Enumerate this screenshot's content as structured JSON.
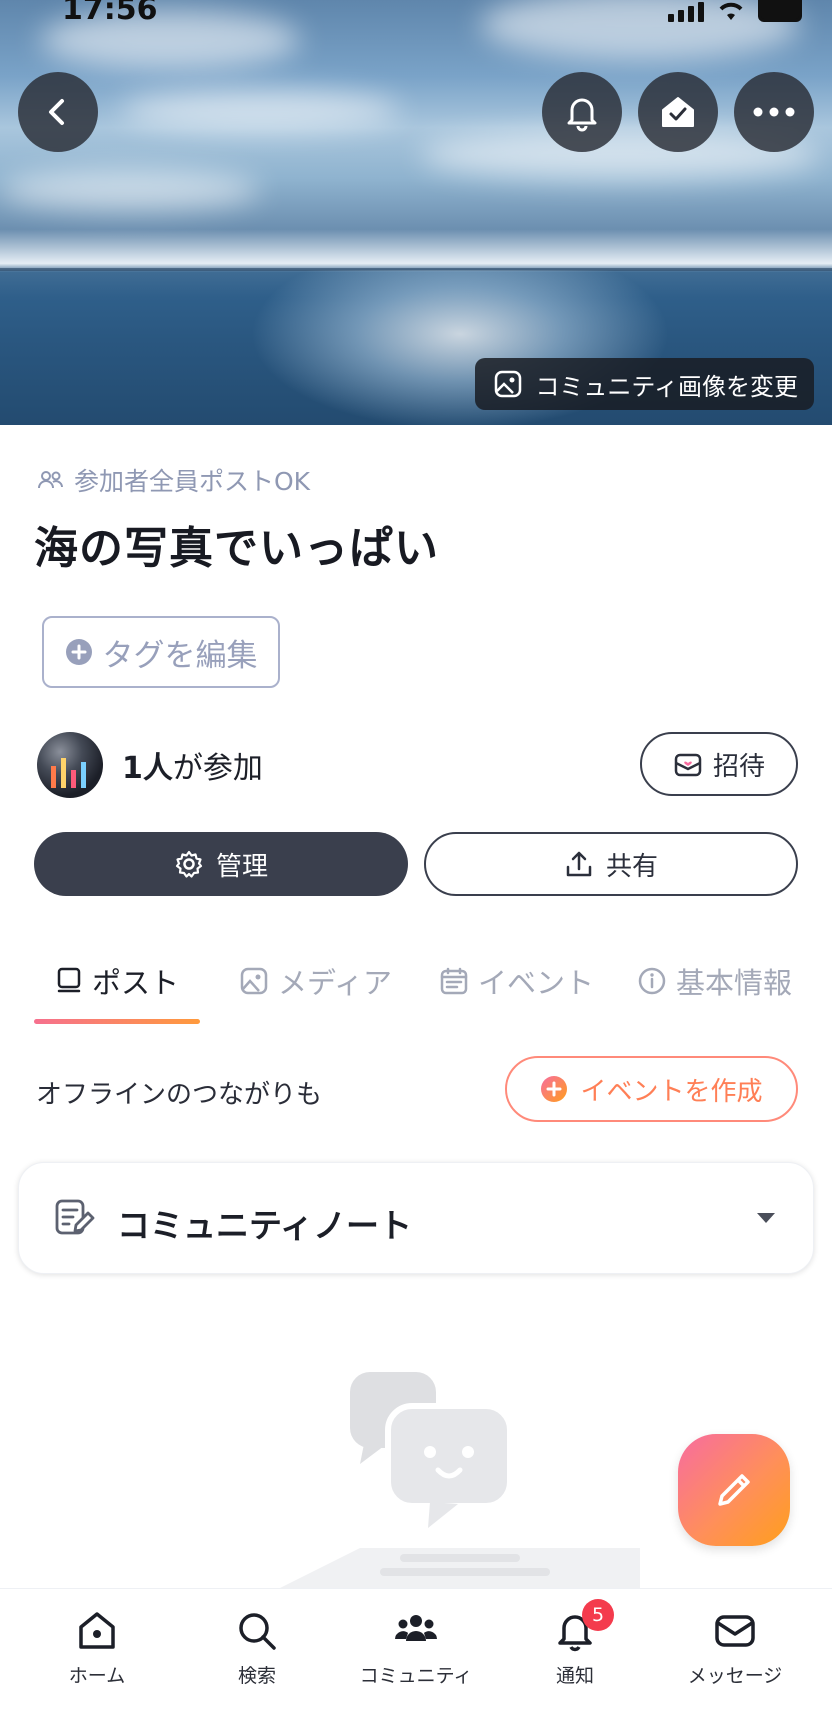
{
  "status": {
    "time": "17:56"
  },
  "header": {
    "change_image_label": "コミュニティ画像を変更",
    "icons": [
      "chevron-left-icon",
      "bell-icon",
      "home-check-icon",
      "more-icon"
    ]
  },
  "community": {
    "permission": "参加者全員ポストOK",
    "title": "海の写真でいっぱい",
    "tag_edit_label": "タグを編集",
    "member_count": "1人",
    "member_suffix": "が参加",
    "invite_label": "招待",
    "manage_label": "管理",
    "share_label": "共有"
  },
  "tabs": [
    {
      "label": "ポスト",
      "active": true
    },
    {
      "label": "メディア",
      "active": false
    },
    {
      "label": "イベント",
      "active": false
    },
    {
      "label": "基本情報",
      "active": false
    }
  ],
  "events": {
    "prompt": "オフラインのつながりも",
    "create_label": "イベントを作成"
  },
  "note": {
    "title": "コミュニティノート"
  },
  "nav": [
    {
      "label": "ホーム"
    },
    {
      "label": "検索"
    },
    {
      "label": "コミュニティ"
    },
    {
      "label": "通知",
      "badge": "5"
    },
    {
      "label": "メッセージ"
    }
  ],
  "colors": {
    "accent_gradient_start": "#f76ca0",
    "accent_gradient_end": "#ff9f1c",
    "dark_button": "#3a3f4d",
    "badge": "#f43b4d"
  }
}
